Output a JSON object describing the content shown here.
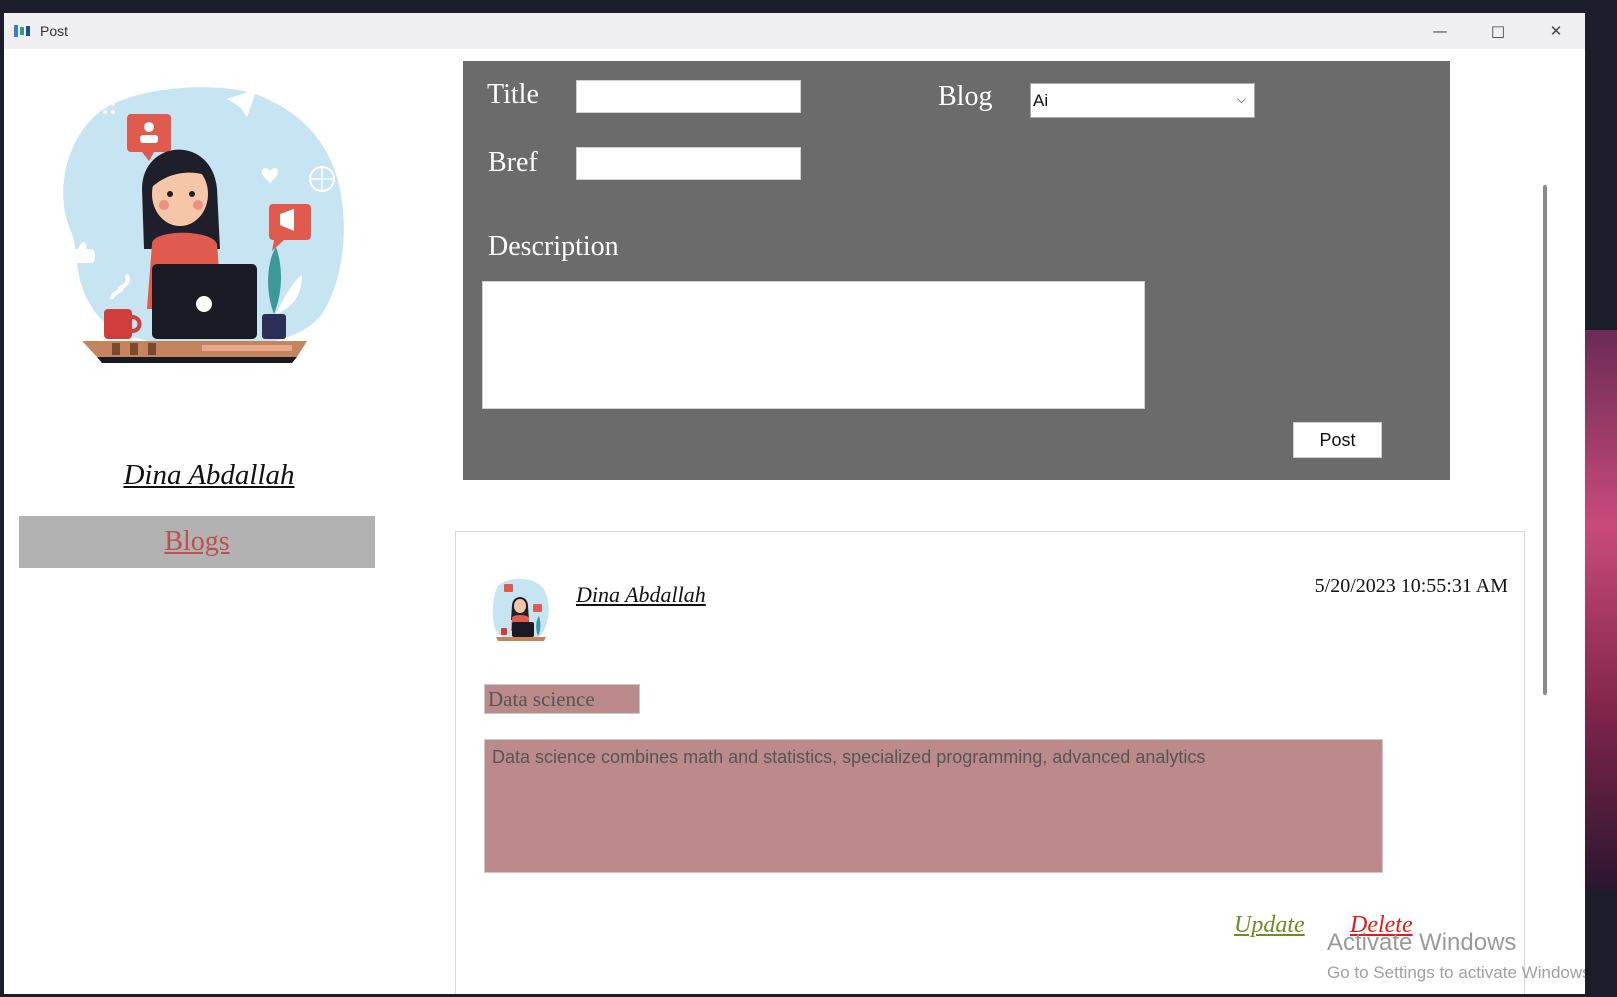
{
  "window": {
    "title": "Post",
    "controls": [
      "minimize",
      "maximize",
      "close"
    ]
  },
  "sidebar": {
    "user_name": "Dina Abdallah",
    "blogs_label": "Blogs"
  },
  "form": {
    "title_label": "Title",
    "title_value": "",
    "brief_label": "Bref",
    "brief_value": "",
    "blog_label": "Blog",
    "blog_selected": "Ai",
    "description_label": "Description",
    "description_value": "",
    "post_button": "Post"
  },
  "post": {
    "author": "Dina Abdallah",
    "timestamp": "5/20/2023 10:55:31 AM",
    "title": "Data science",
    "description": "Data science combines math and statistics, specialized programming, advanced analytics",
    "update_label": "Update",
    "delete_label": "Delete"
  },
  "watermark": {
    "line1": "Activate Windows",
    "line2": "Go to Settings to activate Windows."
  },
  "colors": {
    "panel": "#6b6b6b",
    "blogs_button_bg": "#b2b2b2",
    "blogs_link": "#c0504d",
    "post_fields_bg": "#bc8a8a",
    "update_link": "#6b8e23",
    "delete_link": "#e01b1b"
  }
}
